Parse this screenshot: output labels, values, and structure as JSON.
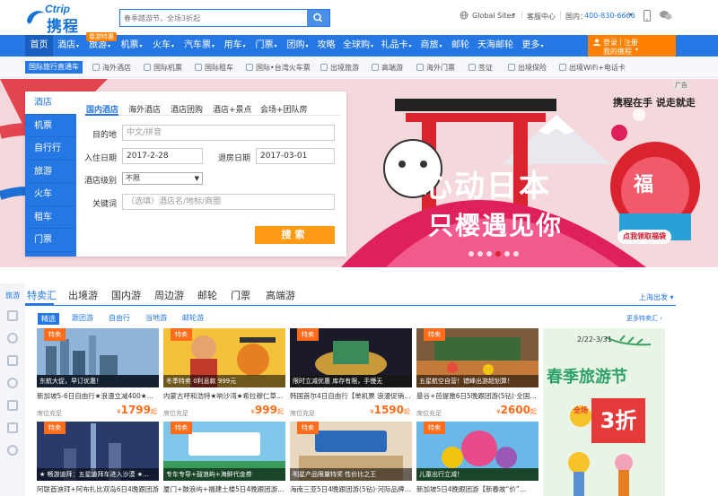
{
  "header": {
    "logo_brand": "Ctrip",
    "logo_cn": "携程",
    "search_placeholder": "春季踏游节，全场3折起",
    "global_sites": "Global Sites",
    "customer_service": "客服中心",
    "hotline_label": "国内：",
    "hotline_number": "400-830-6666"
  },
  "nav": {
    "badge": "春游特惠",
    "items": [
      "首页",
      "酒店",
      "旅游",
      "机票",
      "火车",
      "汽车票",
      "用车",
      "门票",
      "团购",
      "攻略",
      "全球购",
      "礼品卡",
      "商旅",
      "邮轮",
      "天海邮轮",
      "更多"
    ],
    "login": "登录",
    "register": "注册",
    "my_trip": "我的携程"
  },
  "subnav": {
    "intl": "国际旅行直通车",
    "items": [
      "海外酒店",
      "国际机票",
      "国际租车",
      "国际•台湾火车票",
      "出境旅游",
      "高端游",
      "海外门票",
      "签证",
      "出境保险",
      "出境WiFi+电话卡"
    ]
  },
  "hero": {
    "ad_label": "广告",
    "slogan": "携程在手  说走就走",
    "headline_1": "心动日本",
    "headline_2": "只樱遇见你",
    "fu": "福",
    "pill": "点我领取福袋"
  },
  "booking": {
    "side_tabs": [
      "酒店",
      "机票",
      "自行行",
      "旅游",
      "火车",
      "租车",
      "门票"
    ],
    "tabs": [
      "国内酒店",
      "海外酒店",
      "酒店团购",
      "酒店+景点",
      "会场+团队房"
    ],
    "dest_label": "目的地",
    "dest_placeholder": "中文/拼音",
    "checkin_label": "入住日期",
    "checkin": "2017-2-28",
    "checkout_label": "退房日期",
    "checkout": "2017-03-01",
    "level_label": "酒店级别",
    "level_value": "不限",
    "kw_label": "关键词",
    "kw_placeholder": "（选填）酒店名/地标/商圈",
    "search_btn": "搜索"
  },
  "travel": {
    "side_label": "旅游",
    "tabs": [
      "特卖汇",
      "出境游",
      "国内游",
      "周边游",
      "邮轮",
      "门票",
      "高端游"
    ],
    "location": "上海出发",
    "chips": [
      "精选",
      "跟团游",
      "自由行",
      "当地游",
      "邮轮游"
    ],
    "more": "更多特卖汇",
    "cards": [
      {
        "tag": "特卖",
        "caption": "东航大促，早订优惠！",
        "desc": "新加坡5-6日自由行★浪漫立减400★…",
        "seat": "席位充足",
        "price": "1799",
        "unit": "起"
      },
      {
        "tag": "特卖",
        "caption": "冬季特卖 0利息款 999元",
        "desc": "内蒙古呼和浩特★响沙湾★希拉穆仁草…",
        "seat": "席位充足",
        "price": "999",
        "unit": "起"
      },
      {
        "tag": "特卖",
        "caption": "限时立减优惠 库存有限，手慢无",
        "desc": "韩国首尔4日自由行【单机票 浪漫促销…",
        "seat": "席位充足",
        "price": "1590",
        "unit": "起"
      },
      {
        "tag": "特卖",
        "caption": "五星航空自营！错峰出游超划算！",
        "desc": "曼谷+芭提雅6日5晚跟团游(5钻)·全国…",
        "seat": "席位充足",
        "price": "2600",
        "unit": "起"
      }
    ],
    "cards2": [
      {
        "tag": "特卖",
        "caption": "★ 畅游迪拜：五星迪拜车进入沙漠 ★…",
        "desc": "阿联酋迪拜+阿布扎比双岛6日4晚跟团游"
      },
      {
        "tag": "特卖",
        "caption": "专车专导+鼓浪屿+海鲜代金券",
        "desc": "厦门+鼓浪屿+福建土楼5日4晚跟团游…"
      },
      {
        "tag": "特卖",
        "caption": "明星产品限量特奖 性价比之王",
        "desc": "海南三亚5日4晚跟团游(5钻)·河际品牌…"
      },
      {
        "tag": "特卖",
        "caption": "儿童出行立减！",
        "desc": "新加坡5日4晚跟团游【新春故“价”…"
      }
    ],
    "promo": {
      "dates": "2/22-3/31",
      "title": "春季旅游节",
      "big": "3折",
      "small": "全场"
    }
  }
}
